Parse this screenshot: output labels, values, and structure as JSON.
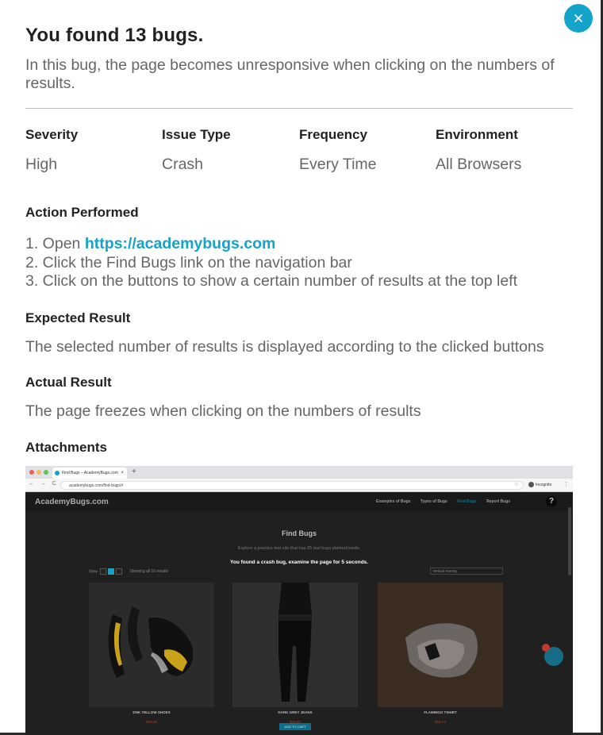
{
  "modal": {
    "title": "You found 13 bugs.",
    "summary": "In this bug, the page becomes unresponsive when clicking on the numbers of results."
  },
  "meta": [
    {
      "label": "Severity",
      "value": "High"
    },
    {
      "label": "Issue Type",
      "value": "Crash"
    },
    {
      "label": "Frequency",
      "value": "Every Time"
    },
    {
      "label": "Environment",
      "value": "All Browsers"
    }
  ],
  "action": {
    "heading": "Action Performed",
    "step1_prefix": "1. Open ",
    "step1_link": "https://academybugs.com",
    "step2": "2. Click the Find Bugs link on the navigation bar",
    "step3": "3. Click on the buttons to show a certain number of results at the top left"
  },
  "expected": {
    "heading": "Expected Result",
    "text": "The selected number of results is displayed according to the clicked buttons"
  },
  "actual": {
    "heading": "Actual Result",
    "text": "The page freezes when clicking on the numbers of results"
  },
  "attachments": {
    "heading": "Attachments",
    "screenshot": {
      "tab_title": "Find Bugs – AcademyBugs.com",
      "tab_close": "×",
      "new_tab": "+",
      "nav_buttons": "← → C",
      "url": "academybugs.com/find-bugs/#",
      "star": "☆",
      "incognito_label": "Incognito",
      "menu": "⋮",
      "site_logo": "AcademyBugs.com",
      "menu_links": [
        "Examples of Bugs",
        "Types of Bugs",
        "Find Bugs",
        "Report Bugs"
      ],
      "help": "?",
      "page_title": "Find Bugs",
      "page_subtitle": "Explore a practice test site that has 25 real bugs planted inside.",
      "crash_message": "You found a crash bug, examine the page for 5 seconds.",
      "view_label": "View",
      "results_label": "Showing all 16 results",
      "sort_label": "Default Sorting",
      "products": [
        {
          "name": "DNK YELLOW SHOES",
          "price": "$40.00"
        },
        {
          "name": "DARK GREY JEANS",
          "price": "$45.00",
          "button": "ADD TO CART"
        },
        {
          "name": "FLAMINGO TSHIRT",
          "price": "$18.74"
        }
      ]
    }
  },
  "colors": {
    "accent": "#14a3c9",
    "text_dark": "#222222",
    "text_muted": "#666666",
    "divider": "#bdbdbd"
  },
  "icons": {
    "close": "close-icon"
  }
}
